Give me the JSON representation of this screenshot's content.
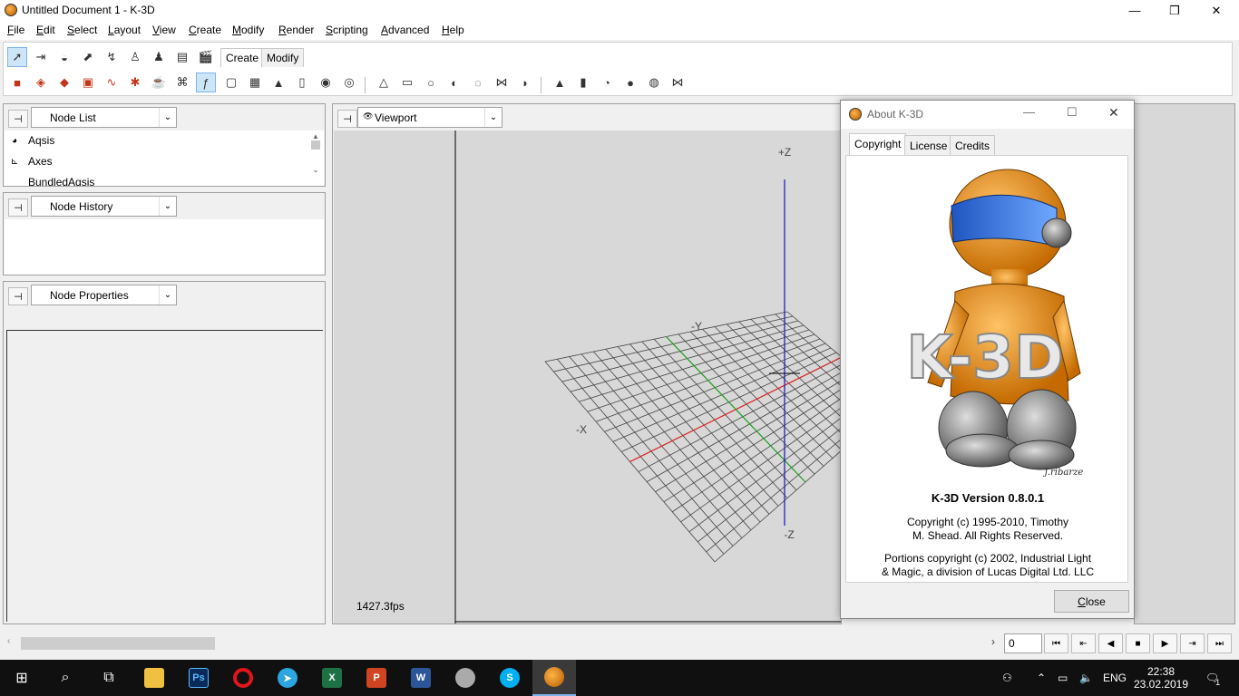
{
  "window": {
    "title": "Untitled Document 1 - K-3D",
    "minimize": "—",
    "restore": "❐",
    "close": "✕"
  },
  "menu": [
    {
      "label": "File",
      "u": "F",
      "rest": "ile"
    },
    {
      "label": "Edit",
      "u": "E",
      "rest": "dit"
    },
    {
      "label": "Select",
      "u": "S",
      "rest": "elect"
    },
    {
      "label": "Layout",
      "u": "L",
      "rest": "ayout"
    },
    {
      "label": "View",
      "u": "V",
      "rest": "iew"
    },
    {
      "label": "Create",
      "u": "C",
      "rest": "reate"
    },
    {
      "label": "Modify",
      "u": "M",
      "rest": "odify"
    },
    {
      "label": "Render",
      "u": "R",
      "rest": "ender"
    },
    {
      "label": "Scripting",
      "u": "S",
      "rest": "cripting"
    },
    {
      "label": "Advanced",
      "u": "A",
      "rest": "dvanced"
    },
    {
      "label": "Help",
      "u": "H",
      "rest": "elp"
    }
  ],
  "toolbar": {
    "tabs": [
      "Create",
      "Modify"
    ],
    "active_tab": "Create"
  },
  "panels": {
    "node_list": {
      "title": "Node List",
      "items": [
        "Aqsis",
        "Axes",
        "BundledAqsis"
      ]
    },
    "node_history": {
      "title": "Node History"
    },
    "node_properties": {
      "title": "Node Properties"
    }
  },
  "viewport": {
    "title": "Viewport",
    "fps": "1427.3fps",
    "axis_labels": {
      "pz": "+Z",
      "nz": "-Z",
      "ny": "-Y",
      "nx": "-X"
    }
  },
  "about": {
    "title": "About K-3D",
    "tabs": [
      "Copyright",
      "License",
      "Credits"
    ],
    "active_tab": "Copyright",
    "logo_text": "K-3D",
    "signature": "j.ribarze",
    "version": "K-3D Version 0.8.0.1",
    "copyright_line1": "Copyright (c) 1995-2010, Timothy",
    "copyright_line2": "M. Shead.  All Rights Reserved.",
    "portions_line1": "Portions copyright (c) 2002, Industrial Light",
    "portions_line2": "& Magic, a division of Lucas Digital Ltd. LLC",
    "close_u": "C",
    "close_rest": "lose"
  },
  "timeline": {
    "frame_value": "0"
  },
  "taskbar": {
    "apps": [
      "Ps"
    ],
    "tray_lang": "ENG",
    "time": "22:38",
    "date": "23.02.2019",
    "notifications": "1"
  },
  "colors": {
    "x_axis": "#e02020",
    "y_axis": "#20a020",
    "z_axis": "#2020c0",
    "accent": "#7eb4ea"
  }
}
